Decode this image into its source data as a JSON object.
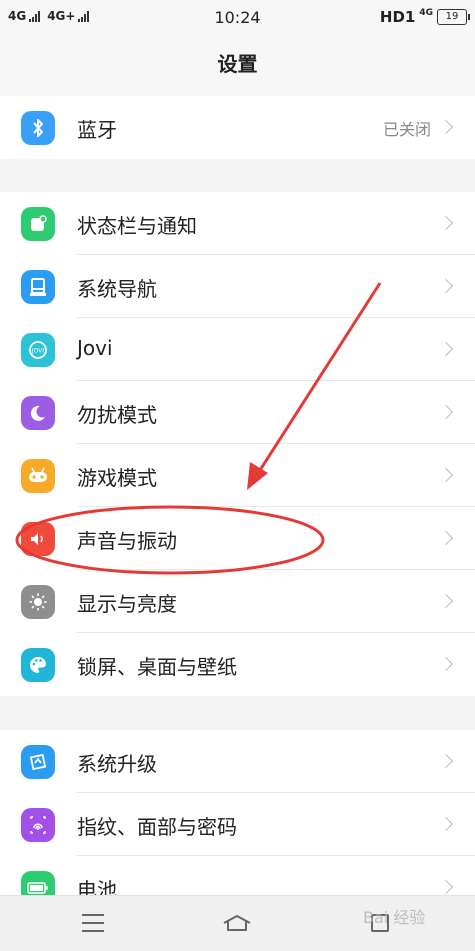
{
  "status_bar": {
    "net1": "4G",
    "net2": "4G+",
    "time": "10:24",
    "hd": "HD1",
    "net3": "4G",
    "battery": "19"
  },
  "header": {
    "title": "设置"
  },
  "groups": [
    {
      "items": [
        {
          "label": "蓝牙",
          "value": "已关闭",
          "icon": "bluetooth-icon",
          "color": "#3aa0f5"
        }
      ]
    },
    {
      "items": [
        {
          "label": "状态栏与通知",
          "icon": "notification-icon",
          "color": "#2ecc71"
        },
        {
          "label": "系统导航",
          "icon": "navigation-icon",
          "color": "#2a9cf2"
        },
        {
          "label": "Jovi",
          "icon": "jovi-icon",
          "color": "#2bc3d8"
        },
        {
          "label": "勿扰模式",
          "icon": "moon-icon",
          "color": "#9b5de5"
        },
        {
          "label": "游戏模式",
          "icon": "gamepad-icon",
          "color": "#f7a928"
        },
        {
          "label": "声音与振动",
          "icon": "speaker-icon",
          "color": "#f04a3a"
        },
        {
          "label": "显示与亮度",
          "icon": "brightness-icon",
          "color": "#8e8e8e"
        },
        {
          "label": "锁屏、桌面与壁纸",
          "icon": "palette-icon",
          "color": "#1fb6d8"
        }
      ]
    },
    {
      "items": [
        {
          "label": "系统升级",
          "icon": "upgrade-icon",
          "color": "#2a9cf2"
        },
        {
          "label": "指纹、面部与密码",
          "icon": "fingerprint-icon",
          "color": "#a251e8"
        },
        {
          "label": "电池",
          "icon": "battery-icon",
          "color": "#2ecc71"
        }
      ]
    }
  ],
  "watermark": "Bai 经验",
  "annotation": {
    "arrow_color": "#e53935",
    "ellipse_color": "#e53935"
  }
}
